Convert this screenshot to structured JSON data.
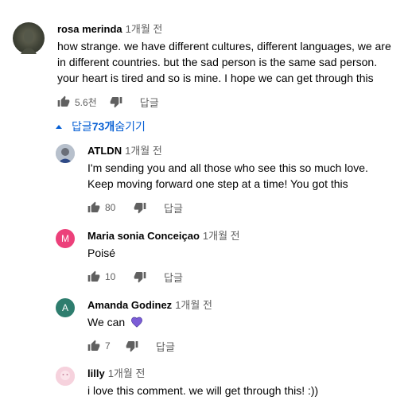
{
  "main_comment": {
    "author": "rosa merinda",
    "time": "1개월 전",
    "text": "how strange. we have different cultures, different languages, we are in different countries. but the sad person is the same sad person. your heart is tired and so is mine. I hope we can get through this",
    "likes": "5.6천",
    "reply_label": "답글"
  },
  "replies_toggle": {
    "prefix": "답글 ",
    "count": "73개",
    "suffix": " 숨기기"
  },
  "replies": [
    {
      "author": "ATLDN",
      "time": "1개월 전",
      "text": "I'm sending you and all those who see this so much love. Keep moving forward one step at a time! You got this",
      "likes": "80",
      "reply_label": "답글",
      "avatar_letter": "",
      "avatar_color": "#9aa3b0"
    },
    {
      "author": "Maria sonia Conceiçao",
      "time": "1개월 전",
      "text": "Poisé",
      "likes": "10",
      "reply_label": "답글",
      "avatar_letter": "M",
      "avatar_color": "#ec407a"
    },
    {
      "author": "Amanda Godinez",
      "time": "1개월 전",
      "text": "We can",
      "likes": "7",
      "reply_label": "답글",
      "avatar_letter": "A",
      "avatar_color": "#2e7d6e",
      "emoji": "purple-heart-icon"
    },
    {
      "author": "lilly",
      "time": "1개월 전",
      "text": "i love this comment. we will get through this! :))",
      "avatar_letter": "",
      "avatar_color": "#f3c6d3"
    }
  ],
  "colors": {
    "link_blue": "#065fd4",
    "secondary_text": "#606060",
    "heart_purple": "#7b5cd6"
  }
}
